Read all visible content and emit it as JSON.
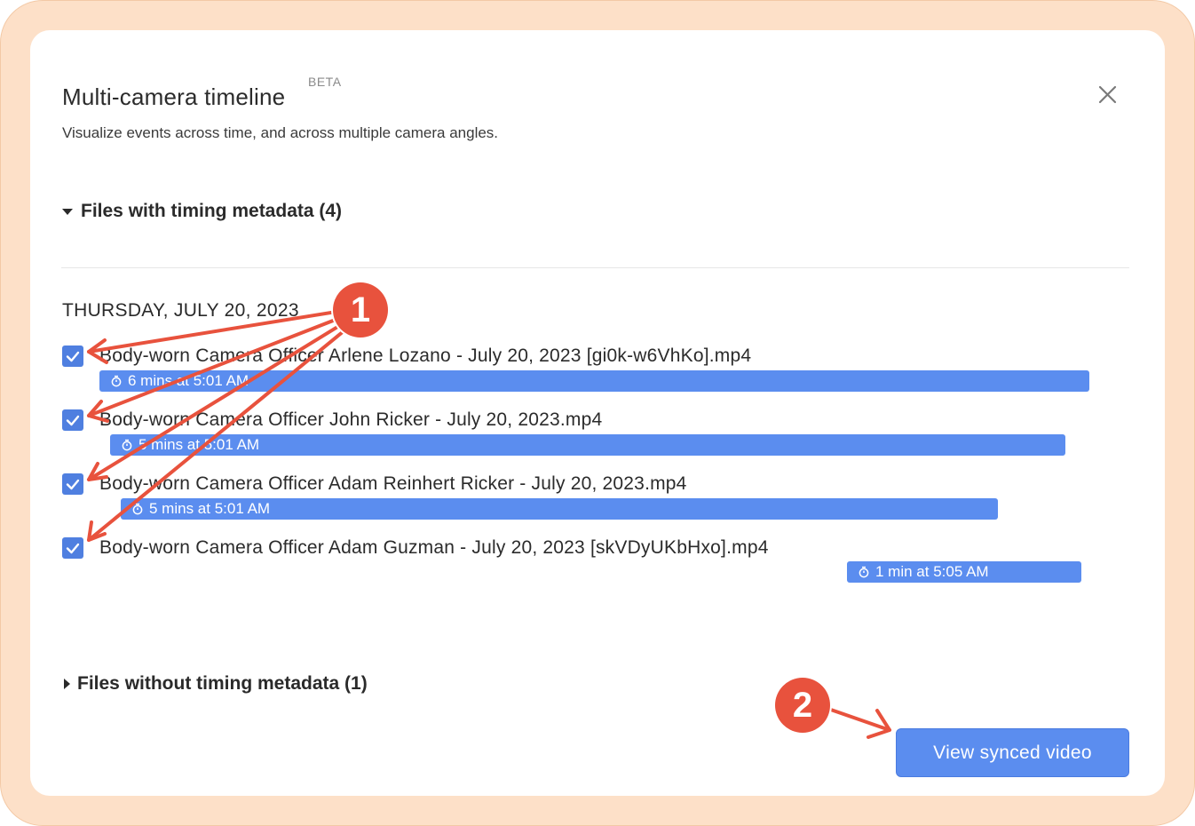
{
  "dialog": {
    "title": "Multi-camera timeline",
    "beta": "BETA",
    "subtitle": "Visualize events across time, and across multiple camera angles."
  },
  "sections": {
    "with_metadata": "Files with timing metadata (4)",
    "without_metadata": "Files without timing metadata (1)"
  },
  "date_heading": "THURSDAY, JULY 20, 2023",
  "files": [
    {
      "name": "Body-worn Camera Officer Arlene Lozano - July 20, 2023 [gi0k-w6VhKo].mp4",
      "duration": "6 mins at 5:01 AM",
      "checked": true
    },
    {
      "name": "Body-worn Camera Officer John Ricker - July 20, 2023.mp4",
      "duration": "5 mins at 5:01 AM",
      "checked": true
    },
    {
      "name": "Body-worn Camera Officer Adam Reinhert Ricker - July 20, 2023.mp4",
      "duration": "5 mins at 5:01 AM",
      "checked": true
    },
    {
      "name": "Body-worn Camera Officer Adam Guzman - July 20, 2023 [skVDyUKbHxo].mp4",
      "duration": "1 min at 5:05 AM",
      "checked": true
    }
  ],
  "primary_button": "View synced video",
  "annotations": {
    "step1": "1",
    "step2": "2"
  },
  "colors": {
    "accent": "#5b8def",
    "checkbox": "#4f7fe0",
    "annotation": "#e8523d",
    "frame": "#fde0c8"
  },
  "icons": [
    "close-icon",
    "caret-down-icon",
    "caret-right-icon",
    "checkmark-icon",
    "timer-icon"
  ]
}
